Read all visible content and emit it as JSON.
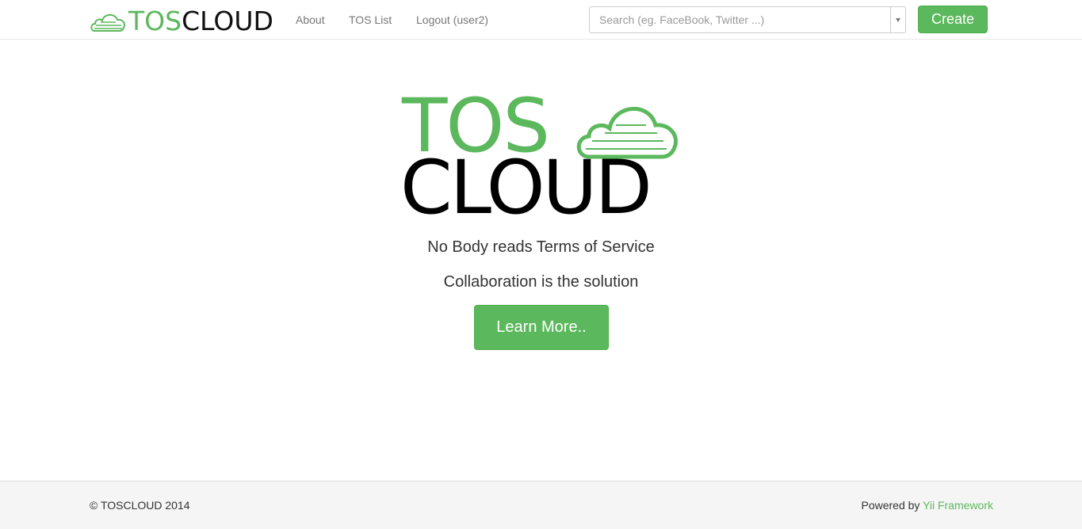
{
  "navbar": {
    "brand": {
      "part1": "TOS",
      "part2": "CLOUD",
      "icon": "cloud-icon"
    },
    "links": {
      "about": "About",
      "tos_list": "TOS List",
      "logout": "Logout (user2)"
    },
    "search": {
      "placeholder": "Search (eg. FaceBook, Twitter ...)",
      "value": ""
    },
    "create_label": "Create"
  },
  "hero": {
    "logo": {
      "part1": "TOS",
      "part2": "CLOUD",
      "icon": "cloud-icon"
    },
    "tagline1": "No Body reads Terms of Service",
    "tagline2": "Collaboration is the solution",
    "learn_more_label": "Learn More.."
  },
  "footer": {
    "copyright": "© TOSCLOUD 2014",
    "powered_prefix": "Powered by ",
    "powered_link": "Yii Framework"
  },
  "colors": {
    "accent": "#5cb85c",
    "footer_bg": "#f5f5f5"
  }
}
